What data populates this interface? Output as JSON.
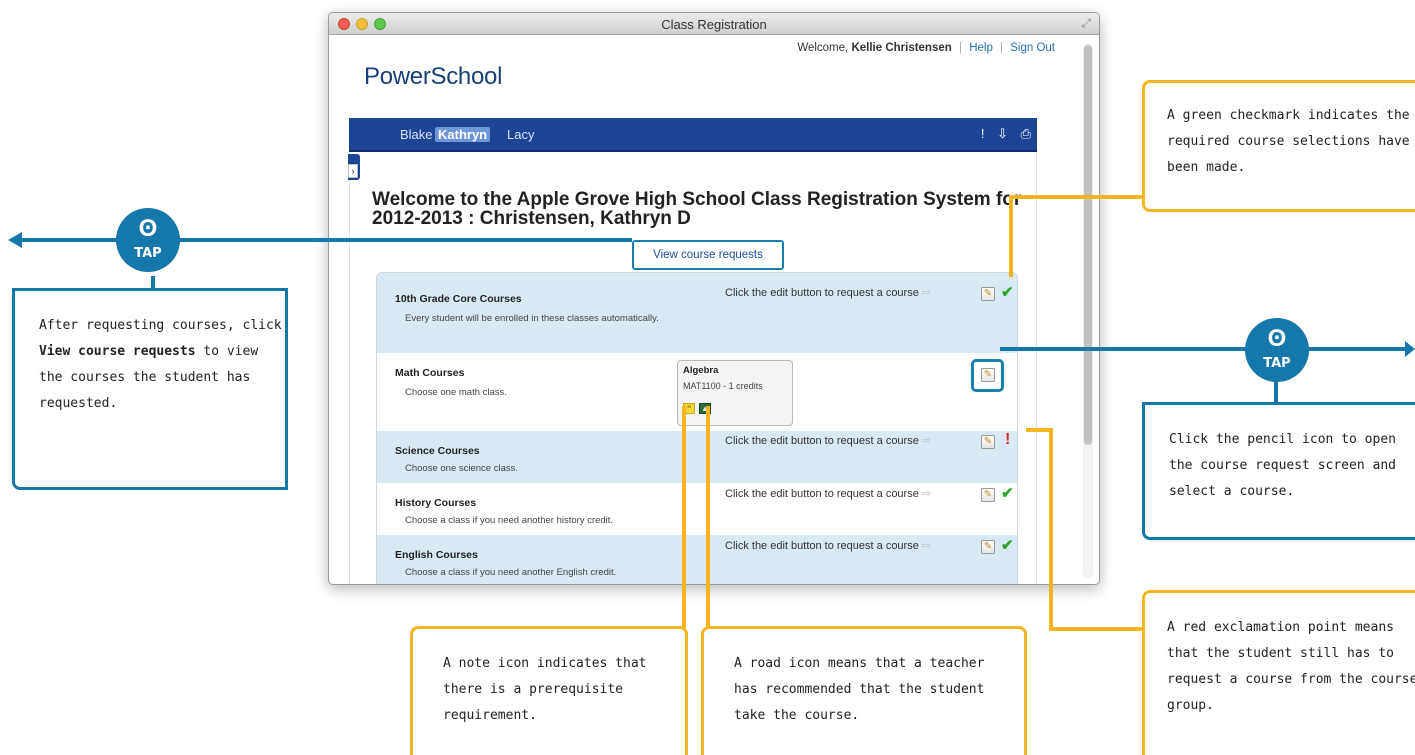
{
  "window": {
    "title": "Class Registration"
  },
  "header": {
    "welcome_prefix": "Welcome,",
    "user_name": "Kellie Christensen",
    "help_label": "Help",
    "signout_label": "Sign Out",
    "logo": "PowerSchool"
  },
  "navbar": {
    "students": [
      "Blake",
      "Kathryn",
      "Lacy"
    ],
    "active_student": "Kathryn",
    "icons": [
      "exclamation-icon",
      "download-icon",
      "print-icon"
    ]
  },
  "page": {
    "title": "Welcome to the Apple Grove High School Class Registration System for 2012-2013 : Christensen, Kathryn D",
    "view_requests_label": "View course requests"
  },
  "course_groups": [
    {
      "name": "10th Grade Core Courses",
      "description": "Every student will be enrolled in these classes automatically.",
      "hint": "Click the edit button to request a course",
      "status": "complete"
    },
    {
      "name": "Math Courses",
      "description": "Choose one math class.",
      "selected_course": "Algebra",
      "selected_detail": "MAT1100 - 1 credits",
      "status": "selected"
    },
    {
      "name": "Science Courses",
      "description": "Choose one science class.",
      "hint": "Click the edit button to request a course",
      "status": "incomplete"
    },
    {
      "name": "History Courses",
      "description": "Choose a class if you need another history credit.",
      "hint": "Click the edit button to request a course",
      "status": "complete"
    },
    {
      "name": "English Courses",
      "description": "Choose a class if you need another English credit.",
      "hint": "Click the edit button to request a course",
      "status": "complete"
    }
  ],
  "callouts": {
    "view_requests": {
      "pre": "After requesting courses, click ",
      "bold": "View course requests",
      "post": " to view the courses the student has requested."
    },
    "checkmark": "A green checkmark indicates the required course selections have been made.",
    "pencil": "Click the pencil icon to open the course request screen and select a course.",
    "exclamation": "A red exclamation point means that the student still has to request a course from the course group.",
    "note": "A note icon indicates that there is a prerequisite requirement.",
    "road": "A road icon means that a teacher has recommended that the student take the course."
  },
  "tap_label": "TAP",
  "colors": {
    "navbar": "#1c4595",
    "callout_orange": "#f4b521",
    "callout_blue": "#1677aa",
    "check_green": "#2ea32e",
    "exclamation_red": "#d8232a"
  }
}
